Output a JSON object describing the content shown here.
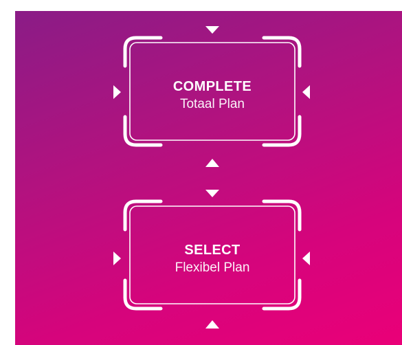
{
  "colors": {
    "gradient_start": "#8a1c86",
    "gradient_end": "#ea0078",
    "frame": "#ffffff",
    "text": "#ffffff"
  },
  "plans": [
    {
      "title": "COMPLETE",
      "subtitle": "Totaal Plan"
    },
    {
      "title": "SELECT",
      "subtitle": "Flexibel Plan"
    }
  ],
  "icons": {
    "arrow_top": "triangle-down-icon",
    "arrow_bottom": "triangle-up-icon",
    "arrow_left": "triangle-right-icon",
    "arrow_right": "triangle-left-icon"
  }
}
